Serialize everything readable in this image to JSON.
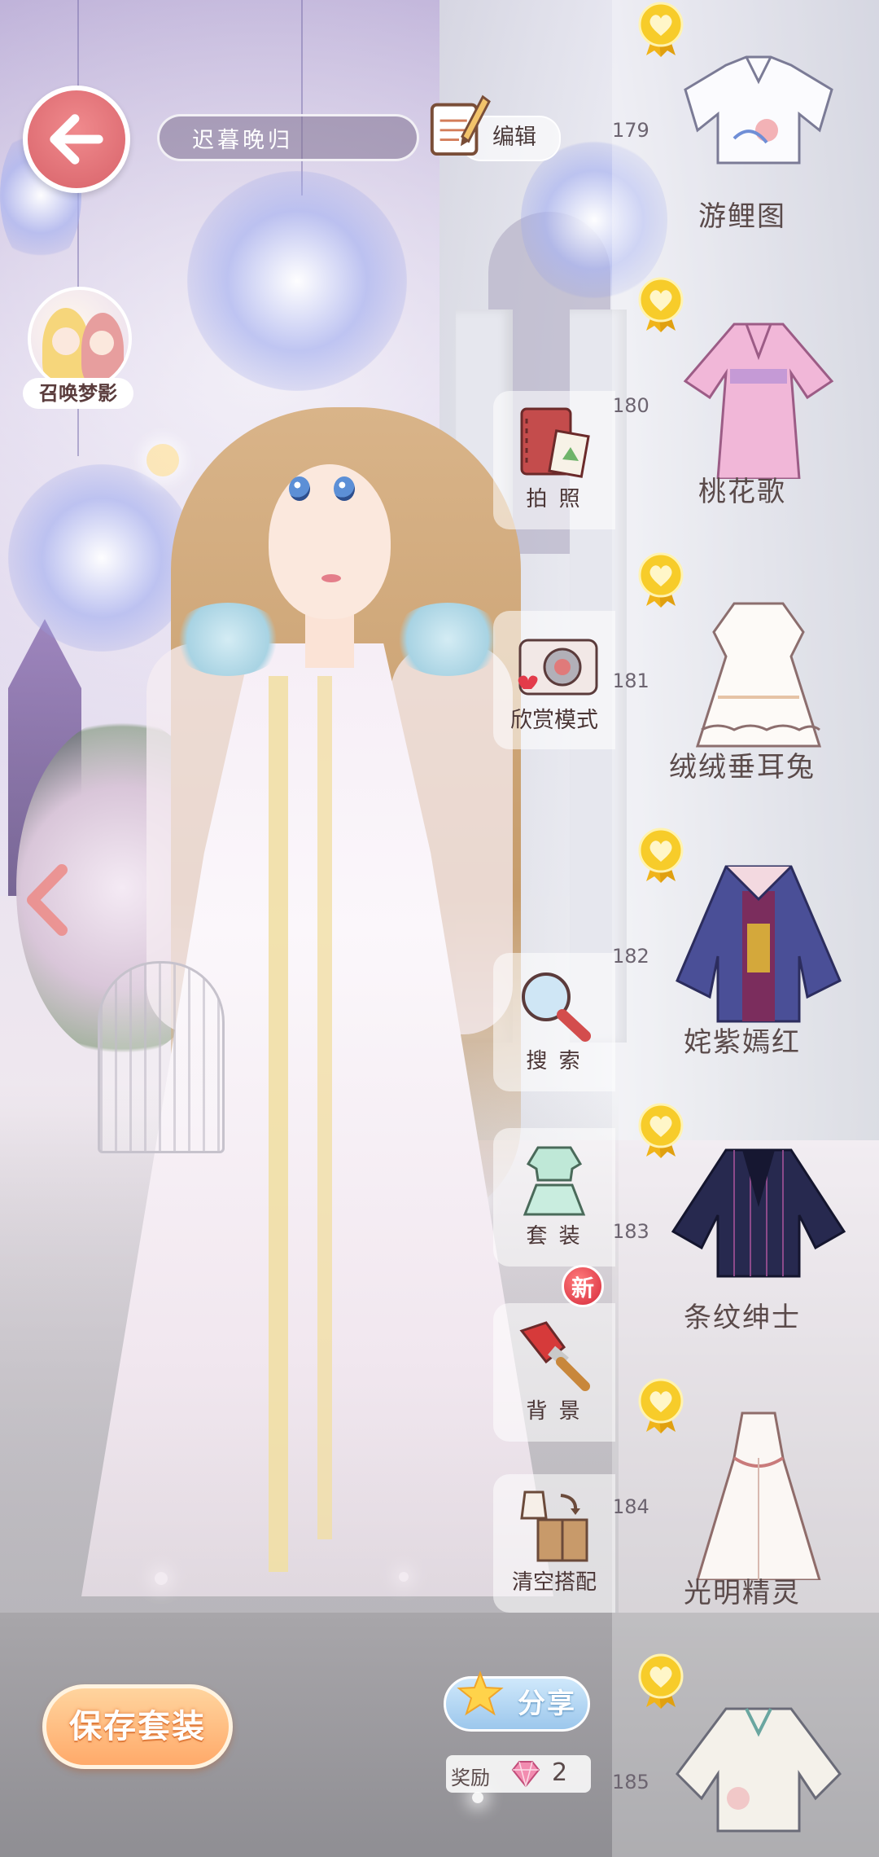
{
  "header": {
    "outfit_name": "迟暮晚归",
    "edit_label": "编辑"
  },
  "summon": {
    "label": "召唤梦影"
  },
  "tools": [
    {
      "label": "拍 照",
      "icon": "photo-album-icon"
    },
    {
      "label": "欣赏模式",
      "icon": "camera-icon"
    },
    {
      "label": "搜 索",
      "icon": "magnifier-icon"
    },
    {
      "label": "套 装",
      "icon": "outfit-icon"
    },
    {
      "label": "背 景",
      "icon": "paintbrush-icon"
    },
    {
      "label": "清空搭配",
      "icon": "box-clear-icon"
    }
  ],
  "new_badge": "新",
  "items": [
    {
      "number": "179",
      "name": "游鲤图",
      "icon": "qipao-top-icon"
    },
    {
      "number": "180",
      "name": "桃花歌",
      "icon": "pink-hanfu-dress-icon"
    },
    {
      "number": "181",
      "name": "绒绒垂耳兔",
      "icon": "white-lolita-dress-icon"
    },
    {
      "number": "182",
      "name": "姹紫嫣红",
      "icon": "purple-robe-icon"
    },
    {
      "number": "183",
      "name": "条纹绅士",
      "icon": "striped-jacket-icon"
    },
    {
      "number": "184",
      "name": "光明精灵",
      "icon": "white-gown-icon"
    },
    {
      "number": "185",
      "name": "",
      "icon": "cheongsam-top-icon"
    }
  ],
  "bottom": {
    "save_label": "保存套装",
    "share_label": "分享",
    "reward_label": "奖励",
    "reward_count": "2"
  },
  "colors": {
    "back_button": "#e2747a",
    "save_button": "#ffb77a",
    "share_button": "#a9d0f0",
    "medal_gold": "#f5c518"
  }
}
